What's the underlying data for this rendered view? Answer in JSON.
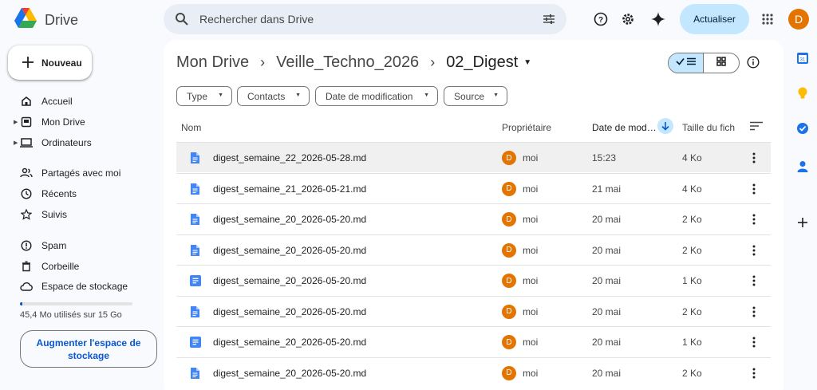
{
  "app": {
    "name": "Drive"
  },
  "search": {
    "placeholder": "Rechercher dans Drive"
  },
  "header": {
    "upgrade_label": "Actualiser",
    "avatar_letter": "D"
  },
  "sidebar": {
    "new_label": "Nouveau",
    "items": [
      {
        "label": "Accueil",
        "icon": "home-icon"
      },
      {
        "label": "Mon Drive",
        "icon": "my-drive-icon",
        "expandable": true
      },
      {
        "label": "Ordinateurs",
        "icon": "computers-icon",
        "expandable": true
      },
      {
        "label": "Partagés avec moi",
        "icon": "shared-icon"
      },
      {
        "label": "Récents",
        "icon": "clock-icon"
      },
      {
        "label": "Suivis",
        "icon": "star-icon"
      },
      {
        "label": "Spam",
        "icon": "spam-icon"
      },
      {
        "label": "Corbeille",
        "icon": "trash-icon"
      },
      {
        "label": "Espace de stockage",
        "icon": "cloud-icon"
      }
    ],
    "storage_text": "45,4 Mo utilisés sur 15 Go",
    "storage_used_fraction": 0.003,
    "storage_button": "Augmenter l'espace de stockage"
  },
  "breadcrumb": {
    "items": [
      "Mon Drive",
      "Veille_Techno_2026"
    ],
    "current": "02_Digest"
  },
  "filters": [
    "Type",
    "Contacts",
    "Date de modification",
    "Source"
  ],
  "table": {
    "columns": {
      "name": "Nom",
      "owner": "Propriétaire",
      "modified": "Date de mod…",
      "size": "Taille du fich"
    },
    "rows": [
      {
        "name": "digest_semaine_22_2026-05-28.md",
        "owner_initial": "D",
        "owner": "moi",
        "modified": "15:23",
        "size": "4 Ko",
        "icon": "doc-file-icon",
        "selected": true
      },
      {
        "name": "digest_semaine_21_2026-05-21.md",
        "owner_initial": "D",
        "owner": "moi",
        "modified": "21 mai",
        "size": "4 Ko",
        "icon": "doc-file-icon"
      },
      {
        "name": "digest_semaine_20_2026-05-20.md",
        "owner_initial": "D",
        "owner": "moi",
        "modified": "20 mai",
        "size": "2 Ko",
        "icon": "doc-file-icon"
      },
      {
        "name": "digest_semaine_20_2026-05-20.md",
        "owner_initial": "D",
        "owner": "moi",
        "modified": "20 mai",
        "size": "2 Ko",
        "icon": "doc-file-icon"
      },
      {
        "name": "digest_semaine_20_2026-05-20.md",
        "owner_initial": "D",
        "owner": "moi",
        "modified": "20 mai",
        "size": "1 Ko",
        "icon": "google-doc-icon"
      },
      {
        "name": "digest_semaine_20_2026-05-20.md",
        "owner_initial": "D",
        "owner": "moi",
        "modified": "20 mai",
        "size": "2 Ko",
        "icon": "doc-file-icon"
      },
      {
        "name": "digest_semaine_20_2026-05-20.md",
        "owner_initial": "D",
        "owner": "moi",
        "modified": "20 mai",
        "size": "1 Ko",
        "icon": "google-doc-icon"
      },
      {
        "name": "digest_semaine_20_2026-05-20.md",
        "owner_initial": "D",
        "owner": "moi",
        "modified": "20 mai",
        "size": "2 Ko",
        "icon": "doc-file-icon"
      }
    ]
  },
  "colors": {
    "accent": "#0b57d0",
    "selected": "#c2e7ff",
    "avatar": "#e37400"
  }
}
